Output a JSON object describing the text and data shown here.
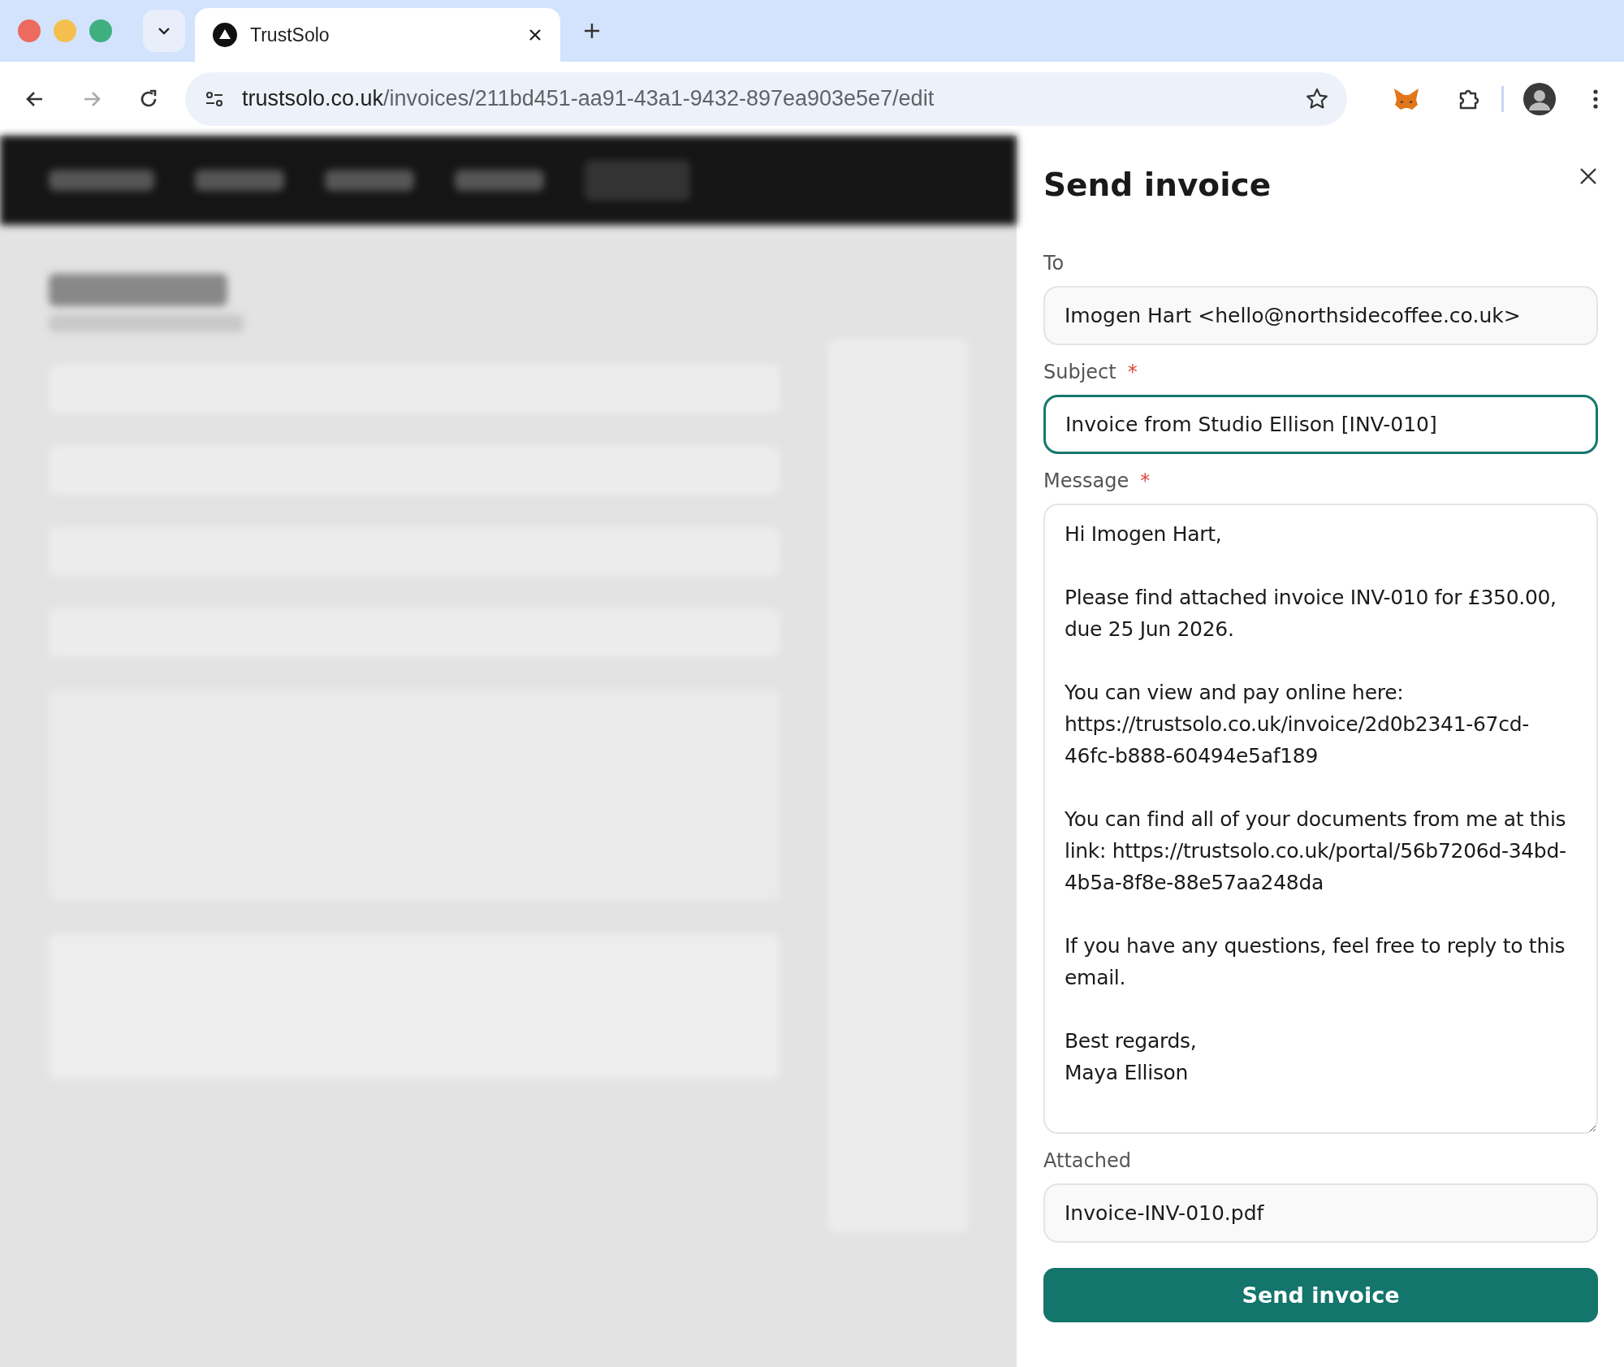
{
  "browser": {
    "tabs": [
      {
        "title": "TrustSolo",
        "selected": true
      }
    ],
    "url_host": "trustsolo.co.uk",
    "url_path": "/invoices/211bd451-aa91-43a1-9432-897ea903e5e7/edit"
  },
  "panel": {
    "title": "Send invoice",
    "fields": [
      {
        "kind": "input",
        "label": "To",
        "focused": false,
        "value": "Imogen Hart <hello@northsidecoffee.co.uk>"
      },
      {
        "kind": "input",
        "label": "Subject",
        "required_mark": "*",
        "focused": true,
        "value": "Invoice from Studio Ellison [INV-010]"
      },
      {
        "kind": "textarea",
        "label": "Message",
        "required_mark": "*",
        "focused": false,
        "value": "Hi Imogen Hart,\n\nPlease find attached invoice INV-010 for £350.00, due 25 Jun 2026.\n\nYou can view and pay online here: https://trustsolo.co.uk/invoice/2d0b2341-67cd-46fc-b888-60494e5af189\n\nYou can find all of your documents from me at this link: https://trustsolo.co.uk/portal/56b7206d-34bd-4b5a-8f8e-88e57aa248da\n\nIf you have any questions, feel free to reply to this email.\n\nBest regards,\nMaya Ellison"
      },
      {
        "kind": "input",
        "label": "Attached",
        "focused": false,
        "value": "Invoice-INV-010.pdf"
      }
    ],
    "button": "Send invoice"
  }
}
